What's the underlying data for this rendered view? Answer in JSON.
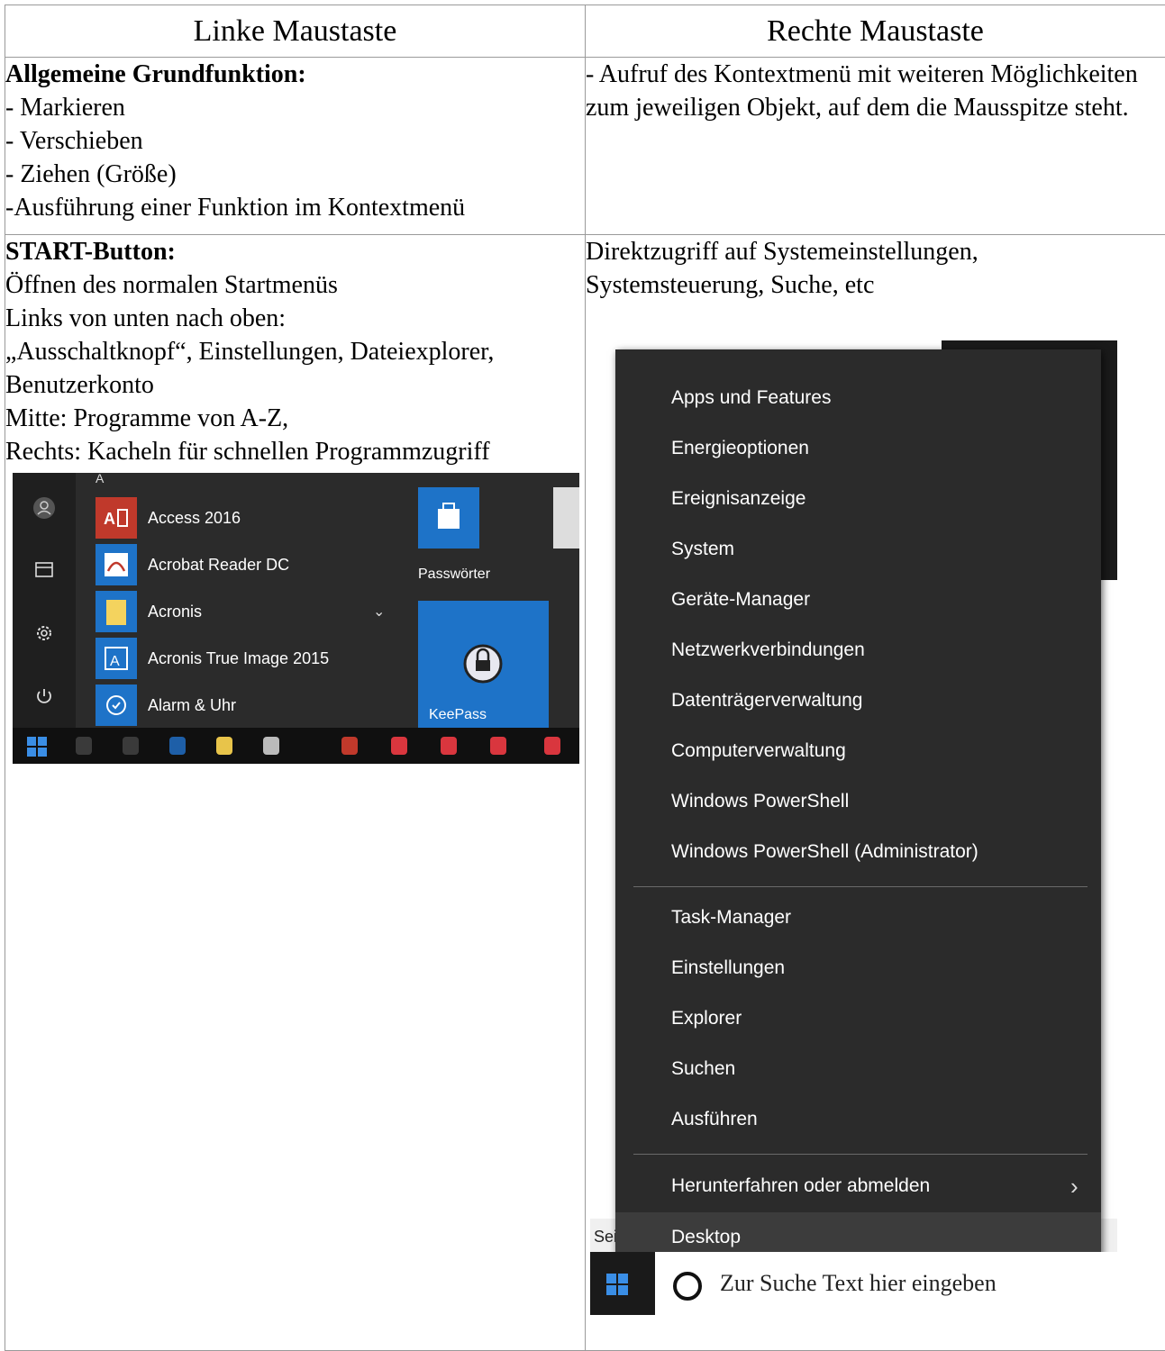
{
  "table": {
    "headers": [
      "Linke Maustaste",
      "Rechte Maustaste"
    ],
    "row1": {
      "left_title": "Allgemeine Grundfunktion:",
      "left_lines": [
        "- Markieren",
        "- Verschieben",
        "- Ziehen (Größe)",
        "-Ausführung einer Funktion im Kontextmenü"
      ],
      "right_text": "- Aufruf des Kontextmenü mit weiteren Möglichkeiten zum jeweiligen Objekt, auf dem die Mausspitze steht."
    },
    "row2": {
      "left_title": "START-Button:",
      "left_lines": [
        "Öffnen des normalen Startmenüs",
        "Links von unten nach oben:",
        "„Ausschaltknopf“, Einstellungen, Dateiexplorer, Benutzerkonto",
        "Mitte: Programme von A-Z,",
        "Rechts: Kacheln für schnellen Programmzugriff"
      ],
      "right_lines": [
        "Direktzugriff auf Systemeinstellungen,",
        "Systemsteuerung, Suche, etc"
      ]
    }
  },
  "start_menu": {
    "letter": "A",
    "apps": [
      {
        "label": "Access 2016",
        "icon": "access-icon",
        "color": "#c0392b"
      },
      {
        "label": "Acrobat Reader DC",
        "icon": "acrobat-icon",
        "color": "#1e73c8"
      },
      {
        "label": "Acronis",
        "icon": "folder-icon",
        "color": "#1e73c8"
      },
      {
        "label": "Acronis True Image 2015",
        "icon": "acronis-icon",
        "color": "#1e73c8"
      },
      {
        "label": "Alarm & Uhr",
        "icon": "alarm-icon",
        "color": "#1e73c8"
      }
    ],
    "tiles": [
      {
        "label": "Passwörter",
        "icon": "store-icon"
      },
      {
        "label": "KeePass",
        "icon": "keepass-icon"
      }
    ],
    "rail_icons": [
      "user-icon",
      "file-explorer-icon",
      "settings-icon",
      "power-icon"
    ]
  },
  "context_menu": {
    "group1": [
      "Apps und Features",
      "Energieoptionen",
      "Ereignisanzeige",
      "System",
      "Geräte-Manager",
      "Netzwerkverbindungen",
      "Datenträgerverwaltung",
      "Computerverwaltung",
      "Windows PowerShell",
      "Windows PowerShell (Administrator)"
    ],
    "group2": [
      "Task-Manager",
      "Einstellungen",
      "Explorer",
      "Suchen",
      "Ausführen"
    ],
    "group3": [
      "Herunterfahren oder abmelden",
      "Desktop"
    ],
    "submenu_arrow": "›",
    "search_placeholder": "Zur Suche Text hier eingeben",
    "partial_text": "Sei"
  }
}
